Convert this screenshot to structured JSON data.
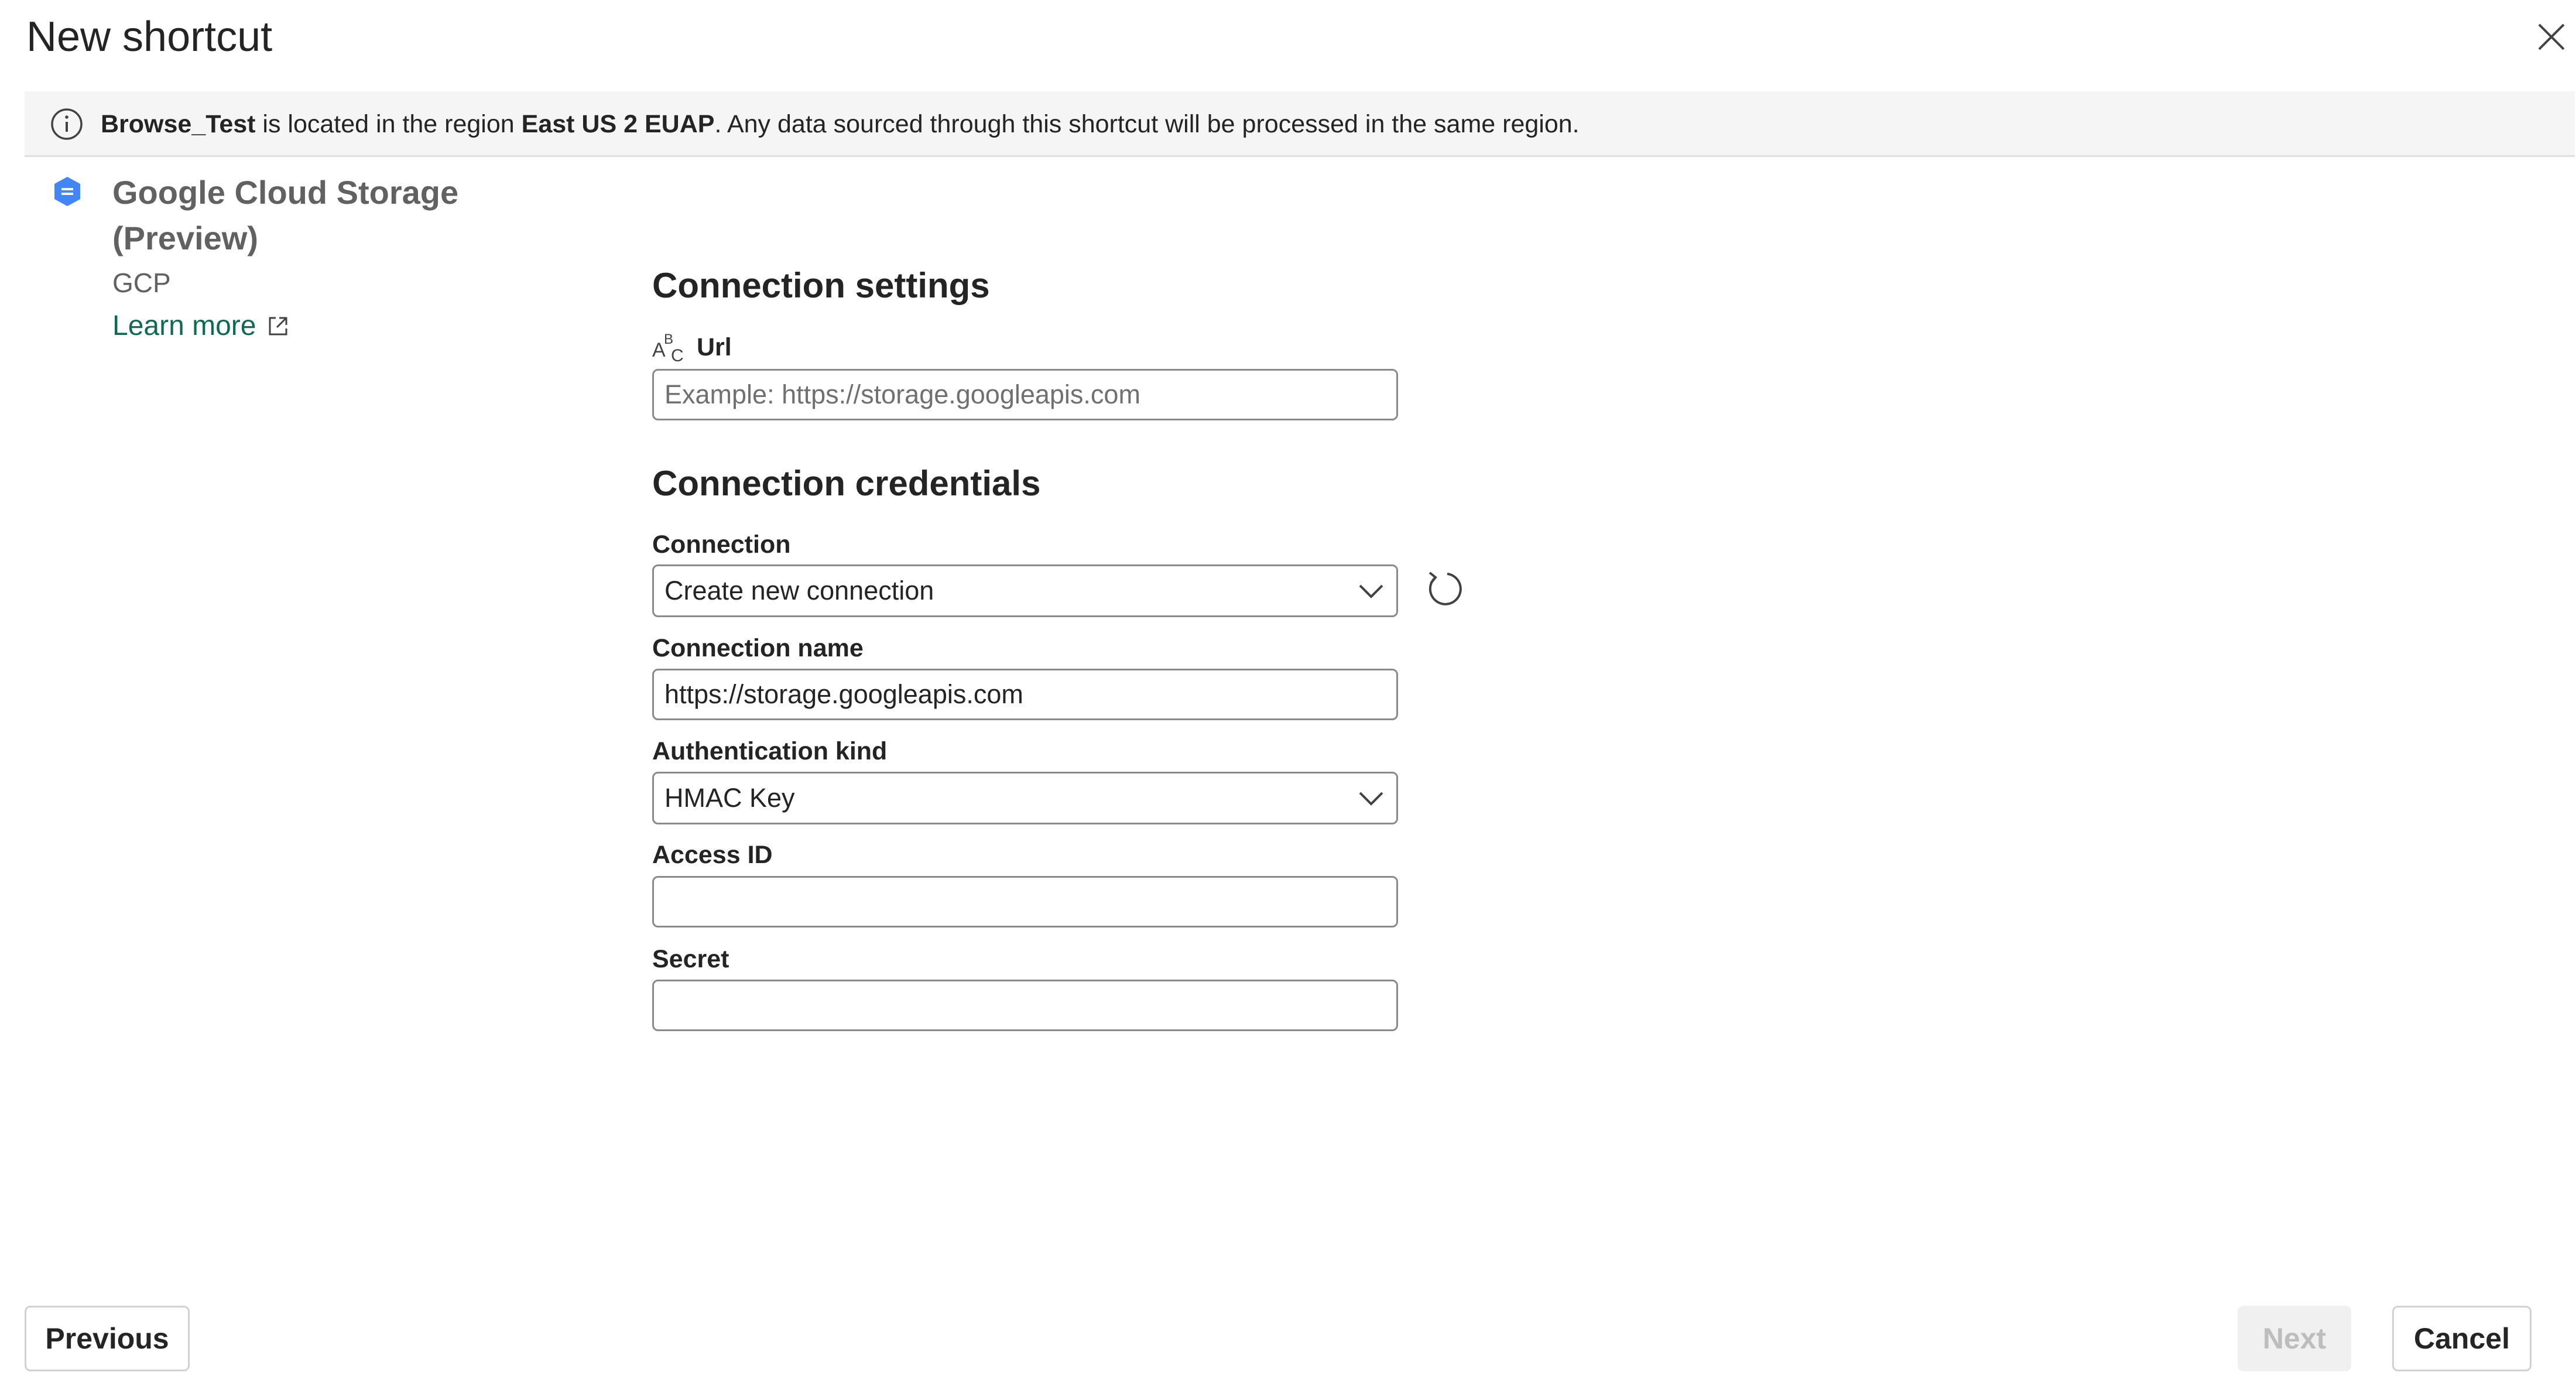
{
  "dialog": {
    "title": "New shortcut"
  },
  "banner": {
    "workspace": "Browse_Test",
    "text_1": " is located in the region ",
    "region": "East US 2 EUAP",
    "text_2": ". Any data sourced through this shortcut will be processed in the same region."
  },
  "source": {
    "name": "Google Cloud Storage (Preview)",
    "short_name": "GCP",
    "learn_more": "Learn more",
    "icon": "gcs-hexagon-icon",
    "icon_color": "#4285f4"
  },
  "connection_settings": {
    "heading": "Connection settings",
    "url_label": "Url",
    "url_placeholder": "Example: https://storage.googleapis.com",
    "url_value": ""
  },
  "connection_credentials": {
    "heading": "Connection credentials",
    "connection_label": "Connection",
    "connection_value": "Create new connection",
    "connection_name_label": "Connection name",
    "connection_name_value": "https://storage.googleapis.com",
    "auth_kind_label": "Authentication kind",
    "auth_kind_value": "HMAC Key",
    "access_id_label": "Access ID",
    "access_id_value": "",
    "secret_label": "Secret",
    "secret_value": ""
  },
  "footer": {
    "previous_label": "Previous",
    "next_label": "Next",
    "cancel_label": "Cancel"
  },
  "colors": {
    "link": "#0f6b4f",
    "banner_bg": "#f5f5f5",
    "disabled_text": "#bdbdbd"
  }
}
